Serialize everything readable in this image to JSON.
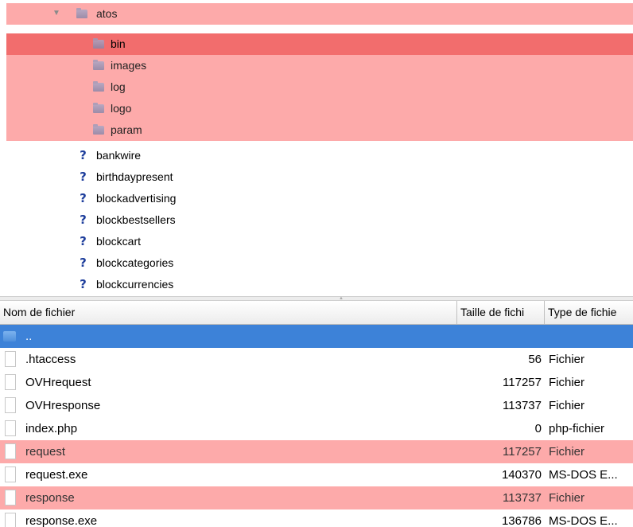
{
  "tree": {
    "items": [
      {
        "label": "atos",
        "icon": "folder-icon",
        "expanded": true,
        "highlight": "pink"
      },
      {
        "label": "bin",
        "icon": "folder-icon",
        "highlight": "selected"
      },
      {
        "label": "images",
        "icon": "folder-icon",
        "highlight": "pink"
      },
      {
        "label": "log",
        "icon": "folder-icon",
        "highlight": "pink"
      },
      {
        "label": "logo",
        "icon": "folder-icon",
        "highlight": "pink"
      },
      {
        "label": "param",
        "icon": "folder-icon",
        "highlight": "pink"
      },
      {
        "label": "bankwire",
        "icon": "question-mark-icon"
      },
      {
        "label": "birthdaypresent",
        "icon": "question-mark-icon"
      },
      {
        "label": "blockadvertising",
        "icon": "question-mark-icon"
      },
      {
        "label": "blockbestsellers",
        "icon": "question-mark-icon"
      },
      {
        "label": "blockcart",
        "icon": "question-mark-icon"
      },
      {
        "label": "blockcategories",
        "icon": "question-mark-icon"
      },
      {
        "label": "blockcurrencies",
        "icon": "question-mark-icon"
      }
    ],
    "disclosure_glyph": "▼",
    "unknown_glyph": "?"
  },
  "file_list": {
    "columns": {
      "name": "Nom de fichier",
      "size": "Taille de fichi",
      "type": "Type de fichie"
    },
    "parent_dir": "..",
    "rows": [
      {
        "name": ".htaccess",
        "size": "56",
        "type": "Fichier"
      },
      {
        "name": "OVHrequest",
        "size": "117257",
        "type": "Fichier"
      },
      {
        "name": "OVHresponse",
        "size": "113737",
        "type": "Fichier"
      },
      {
        "name": "index.php",
        "size": "0",
        "type": "php-fichier"
      },
      {
        "name": "request",
        "size": "117257",
        "type": "Fichier",
        "highlight": "pink"
      },
      {
        "name": "request.exe",
        "size": "140370",
        "type": "MS-DOS E..."
      },
      {
        "name": "response",
        "size": "113737",
        "type": "Fichier",
        "highlight": "pink"
      },
      {
        "name": "response.exe",
        "size": "136786",
        "type": "MS-DOS E..."
      }
    ]
  },
  "colors": {
    "pink_highlight": "#fdaaaa",
    "selected_highlight": "#f26d6d",
    "parent_row_blue": "#3d82d8",
    "question_mark": "#1e3e9c"
  }
}
